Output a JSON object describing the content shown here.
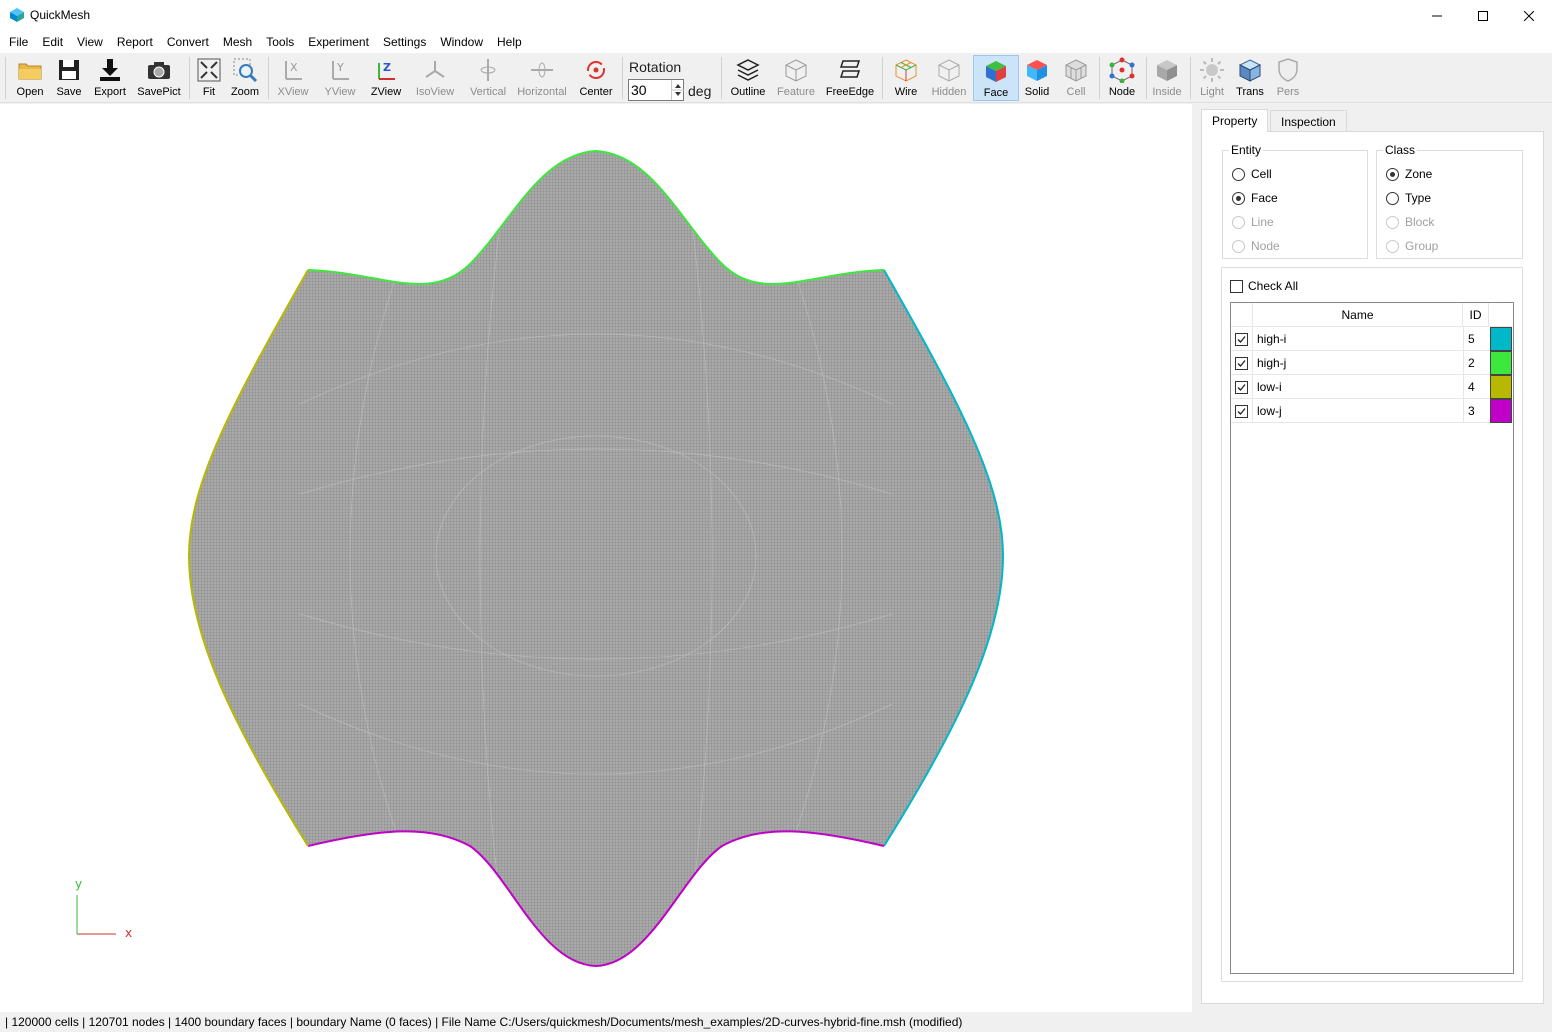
{
  "window": {
    "title": "QuickMesh"
  },
  "menu": [
    "File",
    "Edit",
    "View",
    "Report",
    "Convert",
    "Mesh",
    "Tools",
    "Experiment",
    "Settings",
    "Window",
    "Help"
  ],
  "toolbar": {
    "open": "Open",
    "save": "Save",
    "export": "Export",
    "savepict": "SavePict",
    "fit": "Fit",
    "zoom": "Zoom",
    "xview": "XView",
    "yview": "YView",
    "zview": "ZView",
    "isoview": "IsoView",
    "vertical": "Vertical",
    "horizontal": "Horizontal",
    "center": "Center",
    "rotation_label": "Rotation",
    "rotation_value": "30",
    "rotation_unit": "deg",
    "outline": "Outline",
    "feature": "Feature",
    "freeedge": "FreeEdge",
    "wire": "Wire",
    "hidden": "Hidden",
    "face": "Face",
    "solid": "Solid",
    "cell": "Cell",
    "node": "Node",
    "inside": "Inside",
    "light": "Light",
    "trans": "Trans",
    "pers": "Pers"
  },
  "viewport": {
    "axis_x": "x",
    "axis_y": "y",
    "mesh_color": "#8f8f8f",
    "boundary_colors": {
      "high-i": "#00b8c8",
      "high-j": "#3ce83c",
      "low-i": "#b8b800",
      "low-j": "#c000c8"
    }
  },
  "panel": {
    "tabs": [
      "Property",
      "Inspection"
    ],
    "entity": {
      "title": "Entity",
      "options": [
        {
          "label": "Cell",
          "checked": false,
          "enabled": true
        },
        {
          "label": "Face",
          "checked": true,
          "enabled": true
        },
        {
          "label": "Line",
          "checked": false,
          "enabled": false
        },
        {
          "label": "Node",
          "checked": false,
          "enabled": false
        }
      ]
    },
    "class": {
      "title": "Class",
      "options": [
        {
          "label": "Zone",
          "checked": true,
          "enabled": true
        },
        {
          "label": "Type",
          "checked": false,
          "enabled": true
        },
        {
          "label": "Block",
          "checked": false,
          "enabled": false
        },
        {
          "label": "Group",
          "checked": false,
          "enabled": false
        }
      ]
    },
    "check_all": "Check All",
    "table": {
      "headers": {
        "name": "Name",
        "id": "ID"
      },
      "rows": [
        {
          "name": "high-i",
          "id": "5",
          "color": "#00b8c8",
          "checked": true
        },
        {
          "name": "high-j",
          "id": "2",
          "color": "#3ce83c",
          "checked": true
        },
        {
          "name": "low-i",
          "id": "4",
          "color": "#b8b800",
          "checked": true
        },
        {
          "name": "low-j",
          "id": "3",
          "color": "#c000c8",
          "checked": true
        }
      ]
    }
  },
  "status": "| 120000 cells | 120701 nodes | 1400 boundary faces |  boundary Name  (0 faces) | File Name C:/Users/quickmesh/Documents/mesh_examples/2D-curves-hybrid-fine.msh (modified)"
}
